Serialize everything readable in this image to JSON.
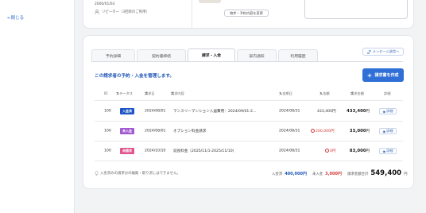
{
  "sidebar": {
    "collapse_label": "←閉じる"
  },
  "customer": {
    "birthdate": "2000/01/03",
    "repeater": "リピーター（3回目のご利用）",
    "change_button": "物件・予約内容を変更"
  },
  "tabs": [
    {
      "label": "予約詳細"
    },
    {
      "label": "契約書締結"
    },
    {
      "label": "請求・入金"
    },
    {
      "label": "案内通知"
    },
    {
      "label": "利用履歴"
    }
  ],
  "message_button": "メッセージ送信へ",
  "section_title": "この請求者の予約・入金を管理します。",
  "create_button": "請求書を作成",
  "table": {
    "headers": {
      "id": "ID",
      "status": "ステータス",
      "billing_date": "請求日",
      "content": "請求内容",
      "deposit_date": "入金期日",
      "deposit": "入金額",
      "billed": "請求金額",
      "action": "詳細"
    },
    "rows": [
      {
        "id": "100",
        "status": "入金済",
        "status_color": "#1e55c4",
        "date": "2024/08/01",
        "content": "マンスリーマンション入居費用：2024/09/01-2...",
        "deposit_date": "2024/08/31",
        "deposit": "433,400円",
        "billed": "433,400",
        "unit": "円",
        "detail": "詳細"
      },
      {
        "id": "100",
        "status": "未入金",
        "status_color": "#a15ad0",
        "date": "2024/08/01",
        "content": "オプション料金請求",
        "deposit_date": "2024/08/31",
        "deposit": "200,000円",
        "billed": "33,000",
        "unit": "円",
        "detail": "詳細"
      },
      {
        "id": "100",
        "status": "未請求",
        "status_color": "#e0558f",
        "date": "2024/10/10",
        "content": "延長料金（2025/11/1-2025/11/10）",
        "deposit_date": "2024/08/31",
        "deposit": "0円",
        "billed": "83,000",
        "unit": "円",
        "detail": "詳細"
      }
    ]
  },
  "footer": {
    "note": "入金済みの請求分の編集・取り消しはできません。",
    "paid_label": "入金済",
    "paid_value": "400,000円",
    "unpaid_label": "未入金",
    "unpaid_value": "3,000円",
    "total_label": "請求金額合計",
    "total_value": "549,400",
    "total_unit": "円"
  }
}
